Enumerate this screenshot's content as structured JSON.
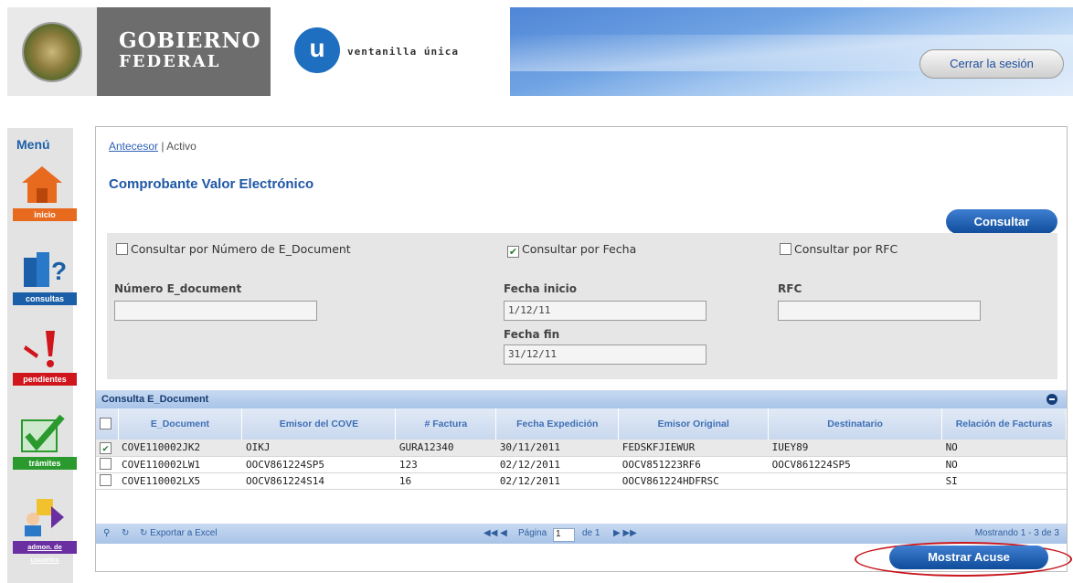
{
  "header": {
    "gob_line1": "Gobierno",
    "gob_line2": "Federal",
    "vu_letter": "u",
    "vu_text": "ventanilla única",
    "logout_label": "Cerrar la sesión"
  },
  "menu": {
    "title": "Menú",
    "items": [
      {
        "label": "inicio",
        "color": "#e86a1e"
      },
      {
        "label": "consultas",
        "color": "#1b5fa8"
      },
      {
        "label": "pendientes",
        "color": "#d0151c"
      },
      {
        "label": "trámites",
        "color": "#2b9a2e"
      },
      {
        "label": "admon. de usuarios",
        "color": "#6a2fa0"
      }
    ]
  },
  "breadcrumb": {
    "link": "Antecesor",
    "sep": " | ",
    "current": "Activo"
  },
  "page_title": "Comprobante Valor Electrónico",
  "consultar_label": "Consultar",
  "filters": {
    "opt_numero": {
      "label": "Consultar por Número de E_Document",
      "checked": false
    },
    "opt_fecha": {
      "label": "Consultar por Fecha",
      "checked": true
    },
    "opt_rfc": {
      "label": "Consultar por RFC",
      "checked": false
    },
    "numero_label": "Número E_document",
    "numero_value": "",
    "fecha_inicio_label": "Fecha inicio",
    "fecha_inicio_value": "1/12/11",
    "fecha_fin_label": "Fecha fin",
    "fecha_fin_value": "31/12/11",
    "rfc_label": "RFC",
    "rfc_value": ""
  },
  "grid": {
    "title": "Consulta E_Document",
    "columns": [
      "E_Document",
      "Emisor del COVE",
      "# Factura",
      "Fecha Expedición",
      "Emisor Original",
      "Destinatario",
      "Relación de Facturas"
    ],
    "rows": [
      {
        "checked": true,
        "cells": [
          "COVE110002JK2",
          "OIKJ",
          "GURA12340",
          "30/11/2011",
          "FEDSKFJIEWUR",
          "IUEY89",
          "NO"
        ]
      },
      {
        "checked": false,
        "cells": [
          "COVE110002LW1",
          "OOCV861224SP5",
          "123",
          "02/12/2011",
          "OOCV851223RF6",
          "OOCV861224SP5",
          "NO"
        ]
      },
      {
        "checked": false,
        "cells": [
          "COVE110002LX5",
          "OOCV861224S14",
          "16",
          "02/12/2011",
          "OOCV861224HDFRSC",
          "",
          "SI"
        ]
      }
    ],
    "export_label": "Exportar a Excel",
    "page_label": "Página",
    "page_value": "1",
    "of_label": "de 1",
    "showing": "Mostrando 1 - 3 de 3"
  },
  "mostrar_label": "Mostrar Acuse"
}
